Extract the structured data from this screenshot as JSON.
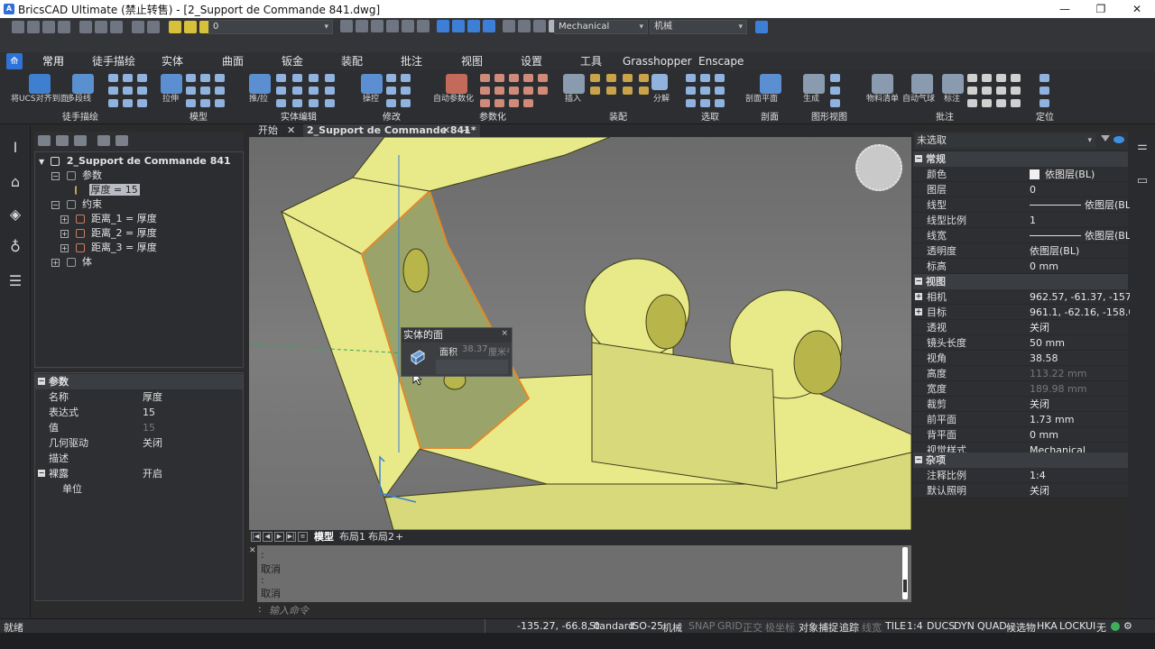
{
  "window": {
    "title": "BricsCAD Ultimate (禁止转售) - [2_Support de Commande 841.dwg]",
    "minimize": "—",
    "maximize": "❐",
    "close": "✕"
  },
  "quickaccess": {
    "layer_value": "0",
    "visual_style": "Mechanical",
    "workspace": "机械"
  },
  "ribbon": {
    "tabs": [
      "常用",
      "徒手描绘",
      "实体",
      "曲面",
      "钣金",
      "装配",
      "批注",
      "视图",
      "设置",
      "工具",
      "Grasshopper",
      "Enscape"
    ],
    "active_tab": "常用",
    "groups": [
      {
        "label": "徒手描绘",
        "captions": [
          "将UCS对齐到面",
          "多段线"
        ]
      },
      {
        "label": "模型",
        "captions": [
          "拉伸"
        ]
      },
      {
        "label": "实体编辑",
        "captions": [
          "推/拉"
        ]
      },
      {
        "label": "修改",
        "captions": [
          "操控"
        ]
      },
      {
        "label": "参数化",
        "captions": [
          "自动参数化"
        ]
      },
      {
        "label": "装配",
        "captions": [
          "插入"
        ]
      },
      {
        "label": "选取",
        "captions": [
          "分解"
        ]
      },
      {
        "label": "剖面",
        "captions": [
          "剖面平面"
        ]
      },
      {
        "label": "图形视图",
        "captions": [
          "生成"
        ]
      },
      {
        "label": "批注",
        "captions": [
          "物料清单",
          "自动气球",
          "标注"
        ]
      },
      {
        "label": "定位",
        "captions": []
      }
    ]
  },
  "tree": {
    "root": "2_Support de Commande 841",
    "nodes": [
      {
        "label": "参数"
      },
      {
        "label": "厚度 = 15"
      },
      {
        "label": "约束"
      },
      {
        "label": "距离_1 = 厚度"
      },
      {
        "label": "距离_2 = 厚度"
      },
      {
        "label": "距离_3 = 厚度"
      },
      {
        "label": "体"
      }
    ]
  },
  "params": {
    "header": "参数",
    "rows": [
      {
        "key": "名称",
        "value": "厚度"
      },
      {
        "key": "表达式",
        "value": "15"
      },
      {
        "key": "值",
        "value": "15"
      },
      {
        "key": "几何驱动",
        "value": "关闭"
      },
      {
        "key": "描述",
        "value": ""
      },
      {
        "key": "裸露",
        "value": "开启"
      },
      {
        "key": "单位",
        "value": ""
      }
    ]
  },
  "doctabs": {
    "start": "开始",
    "active": "2_Support de Commande 841*",
    "close": "✕",
    "add": "+"
  },
  "quadtip": {
    "title": "实体的面",
    "close": "×",
    "label": "面积",
    "value": "38.37",
    "unit": "厘米²"
  },
  "layouts": {
    "tabs": [
      "模型",
      "布局1",
      "布局2"
    ],
    "add": "+"
  },
  "cmd": {
    "history": [
      ":",
      "取消",
      ":",
      "取消"
    ],
    "prompt": ":",
    "placeholder": "输入命令"
  },
  "properties": {
    "selection": "未选取",
    "categories": [
      {
        "label": "常规",
        "rows": [
          {
            "key": "颜色",
            "value": "依图层(BL)",
            "kind": "color"
          },
          {
            "key": "图层",
            "value": "0"
          },
          {
            "key": "线型",
            "value": "依图层(BL)",
            "kind": "line"
          },
          {
            "key": "线型比例",
            "value": "1"
          },
          {
            "key": "线宽",
            "value": "依图层(BL)",
            "kind": "line"
          },
          {
            "key": "透明度",
            "value": "依图层(BL)"
          },
          {
            "key": "标高",
            "value": "0 mm"
          }
        ]
      },
      {
        "label": "视图",
        "rows": [
          {
            "key": "相机",
            "value": "962.57, -61.37, -157.61"
          },
          {
            "key": "目标",
            "value": "961.1, -62.16, -158.09"
          },
          {
            "key": "透视",
            "value": "关闭"
          },
          {
            "key": "镜头长度",
            "value": "50 mm"
          },
          {
            "key": "视角",
            "value": "38.58"
          },
          {
            "key": "高度",
            "value": "113.22 mm",
            "dim": true
          },
          {
            "key": "宽度",
            "value": "189.98 mm",
            "dim": true
          },
          {
            "key": "裁剪",
            "value": "关闭"
          },
          {
            "key": "前平面",
            "value": "1.73 mm"
          },
          {
            "key": "背平面",
            "value": "0 mm"
          },
          {
            "key": "视觉样式",
            "value": "Mechanical"
          }
        ]
      },
      {
        "label": "杂项",
        "rows": [
          {
            "key": "注释比例",
            "value": "1:4"
          },
          {
            "key": "默认照明",
            "value": "关闭"
          }
        ]
      }
    ]
  },
  "status": {
    "ready": "就绪",
    "coords": "-135.27, -66.8, 0",
    "items": [
      {
        "t": "Standard",
        "on": true
      },
      {
        "t": "ISO-25",
        "on": true
      },
      {
        "t": "机械",
        "on": true
      },
      {
        "t": "SNAP",
        "on": false
      },
      {
        "t": "GRID",
        "on": false
      },
      {
        "t": "正交",
        "on": false
      },
      {
        "t": "极坐标",
        "on": false
      },
      {
        "t": "对象捕捉",
        "on": true
      },
      {
        "t": "追踪",
        "on": true
      },
      {
        "t": "线宽",
        "on": false
      },
      {
        "t": "TILE",
        "on": true
      },
      {
        "t": "1:4",
        "on": true
      },
      {
        "t": "DUCS",
        "on": true
      },
      {
        "t": "DYN",
        "on": true
      },
      {
        "t": "QUAD",
        "on": true
      },
      {
        "t": "候选物",
        "on": true
      },
      {
        "t": "HKA",
        "on": true
      },
      {
        "t": "LOCKUI",
        "on": true
      },
      {
        "t": "无",
        "on": true
      }
    ]
  },
  "colors": {
    "model_fill": "#e8ea8a",
    "model_edge": "#3d3d1a",
    "face_highlight": "#9aa46a",
    "face_outline": "#e08a2a",
    "accent": "#2f73d8"
  }
}
